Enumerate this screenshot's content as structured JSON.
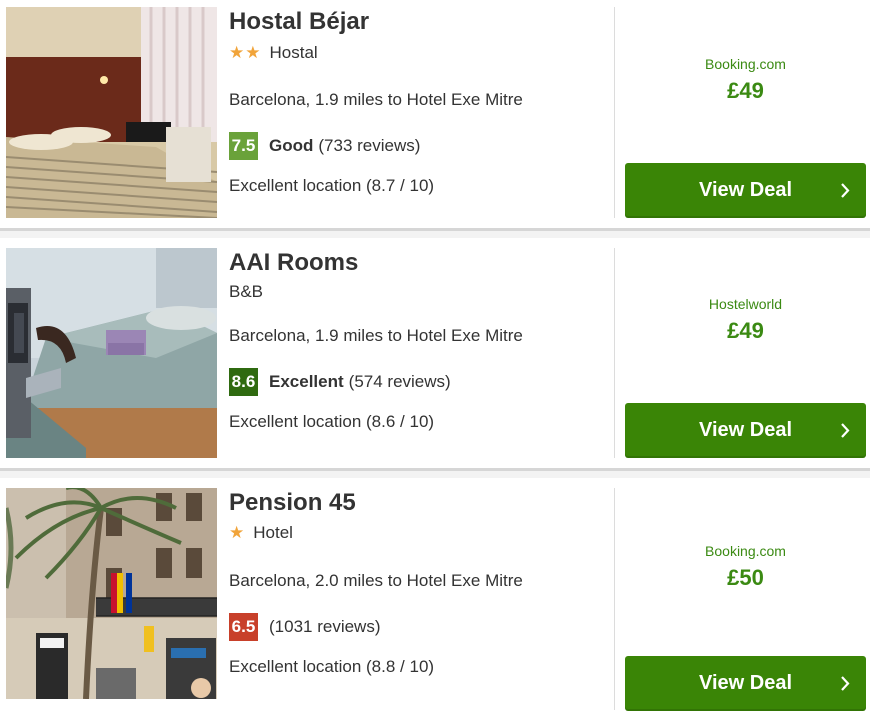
{
  "listings": [
    {
      "name": "Hostal Béjar",
      "stars": "★★",
      "type": "Hostal",
      "location": "Barcelona, 1.9 miles to Hotel Exe Mitre",
      "score": "7.5",
      "score_color": "#6aa23a",
      "rating_label": "Good",
      "reviews": "(733 reviews)",
      "location_score": "Excellent location (8.7 / 10)",
      "provider": "Booking.com",
      "price": "£49",
      "deal_label": "View Deal"
    },
    {
      "name": "AAI Rooms",
      "stars": "",
      "type": "B&B",
      "location": "Barcelona, 1.9 miles to Hotel Exe Mitre",
      "score": "8.6",
      "score_color": "#2f6a10",
      "rating_label": "Excellent",
      "reviews": "(574 reviews)",
      "location_score": "Excellent location (8.6 / 10)",
      "provider": "Hostelworld",
      "price": "£49",
      "deal_label": "View Deal"
    },
    {
      "name": "Pension 45",
      "stars": "★",
      "type": "Hotel",
      "location": "Barcelona, 2.0 miles to Hotel Exe Mitre",
      "score": "6.5",
      "score_color": "#c8402a",
      "rating_label": "",
      "reviews": "(1031 reviews)",
      "location_score": "Excellent location (8.8 / 10)",
      "provider": "Booking.com",
      "price": "£50",
      "deal_label": "View Deal"
    }
  ],
  "colors": {
    "accent_green": "#3a8506",
    "provider_green": "#3b8a13",
    "star_orange": "#f1a43a"
  },
  "icons": {
    "deal_arrow": "chevron-right-icon"
  }
}
